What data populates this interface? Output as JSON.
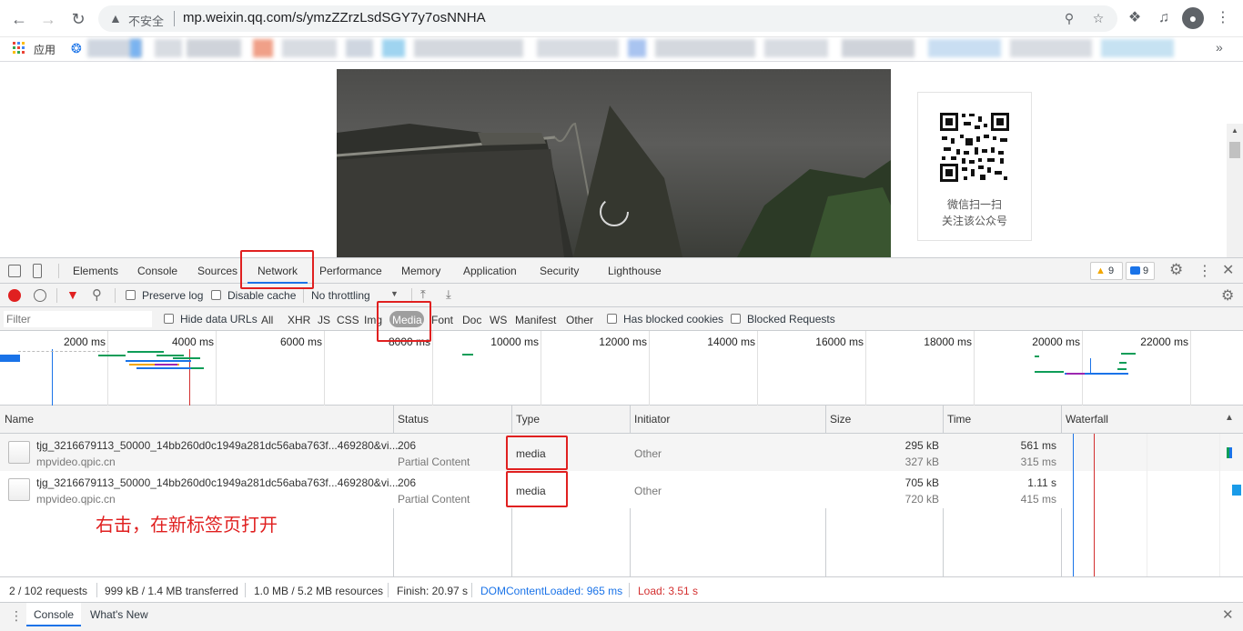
{
  "browser": {
    "nav": {
      "back_icon": "back-arrow-icon",
      "forward_icon": "forward-arrow-icon",
      "reload_icon": "reload-icon"
    },
    "omnibox": {
      "insecure_label": "不安全",
      "url": "mp.weixin.qq.com/s/ymzZZrzLsdSGY7y7osNNHA"
    },
    "bookmarks": {
      "apps_label": "应用",
      "more": "»"
    }
  },
  "page": {
    "qr_caption_line1": "微信扫一扫",
    "qr_caption_line2": "关注该公众号"
  },
  "devtools": {
    "tabs": [
      "Elements",
      "Console",
      "Sources",
      "Network",
      "Performance",
      "Memory",
      "Application",
      "Security",
      "Lighthouse"
    ],
    "selected_tab": "Network",
    "warning_count": "9",
    "message_count": "9",
    "toolbar": {
      "preserve_log": "Preserve log",
      "disable_cache": "Disable cache",
      "throttling": "No throttling"
    },
    "filter": {
      "placeholder": "Filter",
      "hide_data_urls": "Hide data URLs",
      "types": [
        "All",
        "XHR",
        "JS",
        "CSS",
        "Img",
        "Media",
        "Font",
        "Doc",
        "WS",
        "Manifest",
        "Other"
      ],
      "selected_type": "Media",
      "has_blocked_cookies": "Has blocked cookies",
      "blocked_requests": "Blocked Requests"
    },
    "overview_ticks": [
      "2000 ms",
      "4000 ms",
      "6000 ms",
      "8000 ms",
      "10000 ms",
      "12000 ms",
      "14000 ms",
      "16000 ms",
      "18000 ms",
      "20000 ms",
      "22000 ms"
    ],
    "columns": {
      "name": "Name",
      "status": "Status",
      "type": "Type",
      "initiator": "Initiator",
      "size": "Size",
      "time": "Time",
      "waterfall": "Waterfall"
    },
    "rows": [
      {
        "name": "tjg_3216679113_50000_14bb260d0c1949a281dc56aba763f...469280&vi...",
        "domain": "mpvideo.qpic.cn",
        "status": "206",
        "status_text": "Partial Content",
        "type": "media",
        "initiator": "Other",
        "size": "295 kB",
        "resource_size": "327 kB",
        "time": "561 ms",
        "latency": "315 ms"
      },
      {
        "name": "tjg_3216679113_50000_14bb260d0c1949a281dc56aba763f...469280&vi...",
        "domain": "mpvideo.qpic.cn",
        "status": "206",
        "status_text": "Partial Content",
        "type": "media",
        "initiator": "Other",
        "size": "705 kB",
        "resource_size": "720 kB",
        "time": "1.11 s",
        "latency": "415 ms"
      }
    ],
    "status_bar": {
      "requests": "2 / 102 requests",
      "transferred": "999 kB / 1.4 MB transferred",
      "resources": "1.0 MB / 5.2 MB resources",
      "finish": "Finish: 20.97 s",
      "dom_content_loaded": "DOMContentLoaded: 965 ms",
      "load": "Load: 3.51 s"
    },
    "drawer_tabs": [
      "Console",
      "What's New"
    ]
  },
  "annotation_text": "右击，在新标签页打开",
  "colors": {
    "accent": "#1a73e8",
    "annotation": "#e02020",
    "dcl": "#1a73e8",
    "load": "#d32f2f"
  }
}
